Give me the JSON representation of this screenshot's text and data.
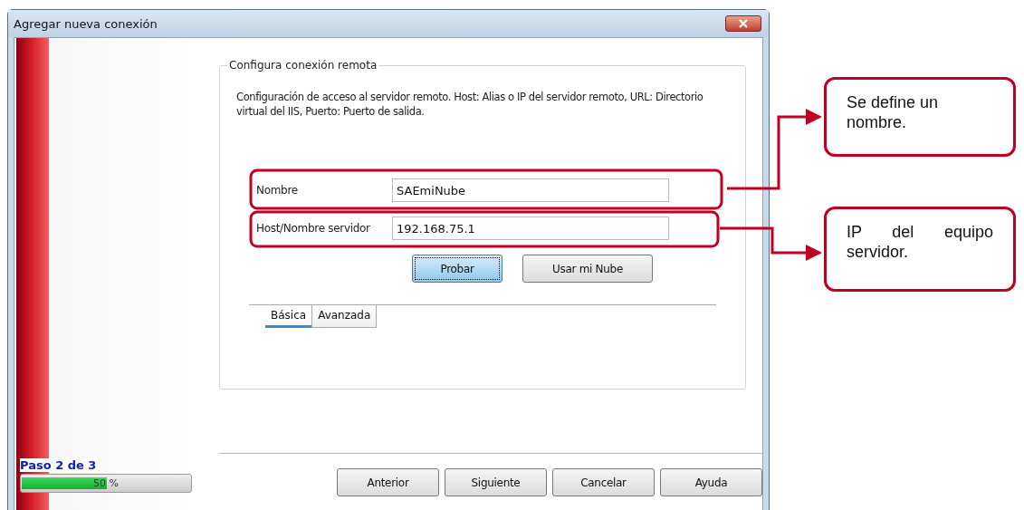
{
  "window": {
    "title": "Agregar nueva conexión"
  },
  "group": {
    "title": "Configura conexión remota",
    "description": "Configuración de acceso al servidor remoto. Host: Alias o IP del servidor remoto, URL: Directorio virtual del IIS, Puerto: Puerto de salida."
  },
  "fields": [
    {
      "label": "Nombre",
      "value": "SAEmiNube"
    },
    {
      "label": "Host/Nombre servidor",
      "value": "192.168.75.1"
    }
  ],
  "actions": [
    {
      "label": "Probar",
      "focused": true
    },
    {
      "label": "Usar mi Nube",
      "focused": false
    }
  ],
  "tabs": [
    {
      "label": "Básica",
      "selected": true
    },
    {
      "label": "Avanzada",
      "selected": false
    }
  ],
  "progress": {
    "step": "Paso 2 de 3",
    "level": 0.5,
    "reading": "50 %"
  },
  "buttons": [
    "Anterior",
    "Siguiente",
    "Cancelar",
    "Ayuda"
  ],
  "callouts": [
    {
      "text": "Se define un nombre."
    },
    {
      "text": "IP del equipo servidor."
    }
  ]
}
